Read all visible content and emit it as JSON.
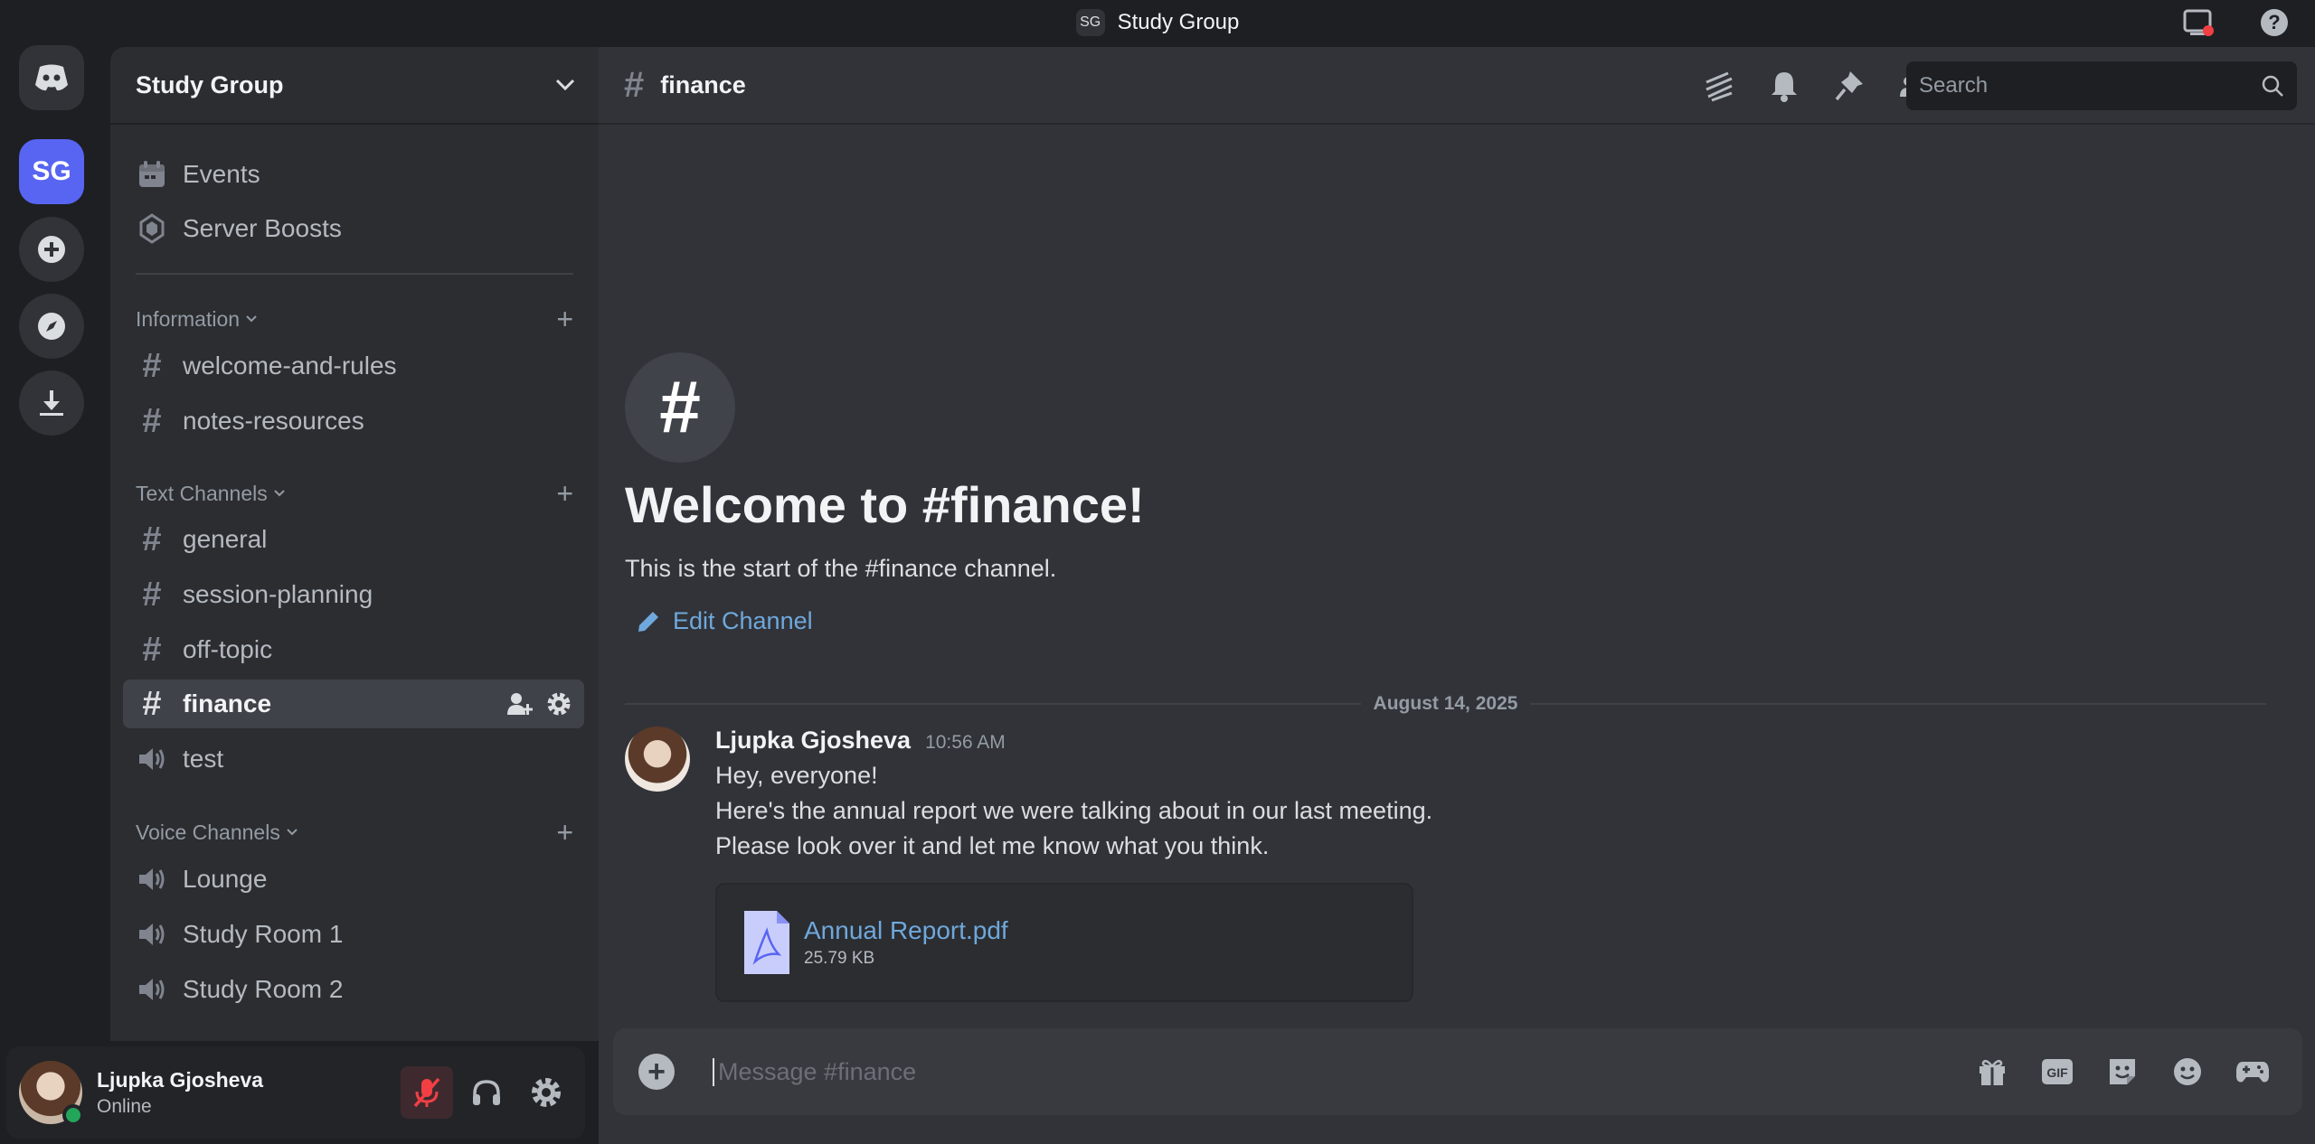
{
  "window": {
    "server_chip": "SG",
    "title": "Study Group"
  },
  "rail": {
    "server_initials": "SG"
  },
  "sidebar": {
    "server_name": "Study Group",
    "top_items": [
      {
        "label": "Events",
        "icon": "calendar-icon"
      },
      {
        "label": "Server Boosts",
        "icon": "boost-icon"
      }
    ],
    "categories": [
      {
        "label": "Information",
        "channels": [
          {
            "label": "welcome-and-rules",
            "type": "text"
          },
          {
            "label": "notes-resources",
            "type": "text"
          }
        ]
      },
      {
        "label": "Text Channels",
        "channels": [
          {
            "label": "general",
            "type": "text"
          },
          {
            "label": "session-planning",
            "type": "text"
          },
          {
            "label": "off-topic",
            "type": "text"
          },
          {
            "label": "finance",
            "type": "text",
            "active": true
          },
          {
            "label": "test",
            "type": "voice"
          }
        ]
      },
      {
        "label": "Voice Channels",
        "channels": [
          {
            "label": "Lounge",
            "type": "voice"
          },
          {
            "label": "Study Room 1",
            "type": "voice"
          },
          {
            "label": "Study Room 2",
            "type": "voice"
          }
        ]
      }
    ]
  },
  "user": {
    "name": "Ljupka Gjosheva",
    "status": "Online"
  },
  "channel": {
    "name": "finance",
    "search_placeholder": "Search",
    "welcome_title": "Welcome to #finance!",
    "welcome_sub": "This is the start of the #finance channel.",
    "edit_label": "Edit Channel"
  },
  "messages": {
    "date": "August 14, 2025",
    "author": "Ljupka Gjosheva",
    "time": "10:56 AM",
    "lines": [
      "Hey, everyone!",
      "Here's the annual report we were talking about in our last meeting.",
      "Please look over it and let me know what you think."
    ],
    "attachment": {
      "name": "Annual Report.pdf",
      "size": "25.79 KB"
    }
  },
  "composer": {
    "placeholder": "Message #finance"
  },
  "colors": {
    "accent": "#5865f2",
    "link": "#6fa8dc",
    "online": "#23a55a",
    "mute_red": "#f23f43"
  }
}
